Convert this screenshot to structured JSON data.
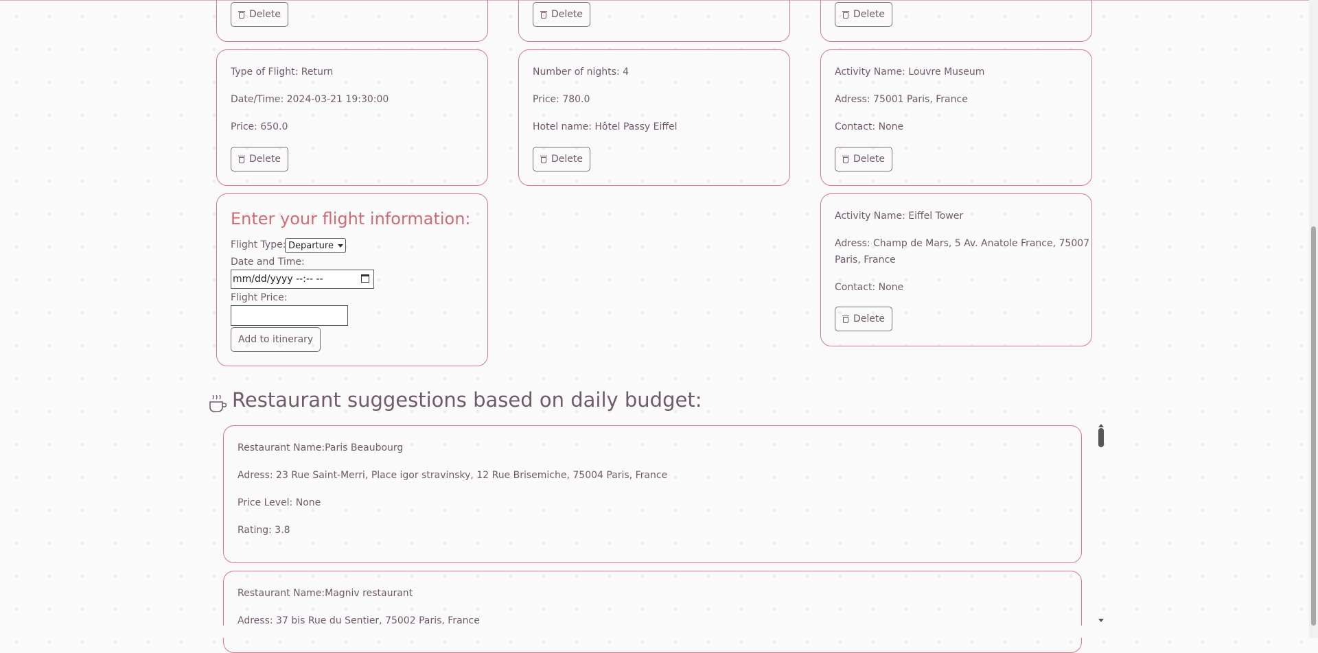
{
  "delete_label": "Delete",
  "flights": [
    {
      "type": "Type of Flight: Return",
      "datetime": "Date/Time: 2024-03-21 19:30:00",
      "price": "Price: 650.0"
    }
  ],
  "hotels": [
    {
      "nights": "Number of nights: 4",
      "price": "Price: 780.0",
      "name": "Hotel name: Hôtel Passy Eiffel"
    }
  ],
  "activities": [
    {
      "name": "Activity Name: Louvre Museum",
      "address": "Adress: 75001 Paris, France",
      "contact": "Contact: None"
    },
    {
      "name": "Activity Name: Eiffel Tower",
      "address_line1": "Adress: Champ de Mars, 5 Av. Anatole France, 75007",
      "address_line2": "Paris, France",
      "contact": "Contact: None"
    }
  ],
  "flight_form": {
    "title": "Enter your flight information:",
    "type_label": "Flight Type:",
    "type_value": "Departure",
    "datetime_label": "Date and Time:",
    "datetime_placeholder": "mm/dd/yyyy --:-- --",
    "price_label": "Flight Price:",
    "price_value": "",
    "submit_label": "Add to itinerary"
  },
  "restaurants_section": {
    "title": "Restaurant suggestions based on daily budget:",
    "icon": "coffee-cup-icon",
    "items": [
      {
        "name": "Restaurant Name:Paris Beaubourg",
        "address": "Adress: 23 Rue Saint-Merri, Place igor stravinsky, 12 Rue Brisemiche, 75004 Paris, France",
        "price_level": "Price Level: None",
        "rating": "Rating: 3.8"
      },
      {
        "name": "Restaurant Name:Magniv restaurant",
        "address": "Adress: 37 bis Rue du Sentier, 75002 Paris, France"
      }
    ]
  },
  "colors": {
    "accent": "#d06b74",
    "border": "#d77a84",
    "text": "#6f5a66"
  }
}
